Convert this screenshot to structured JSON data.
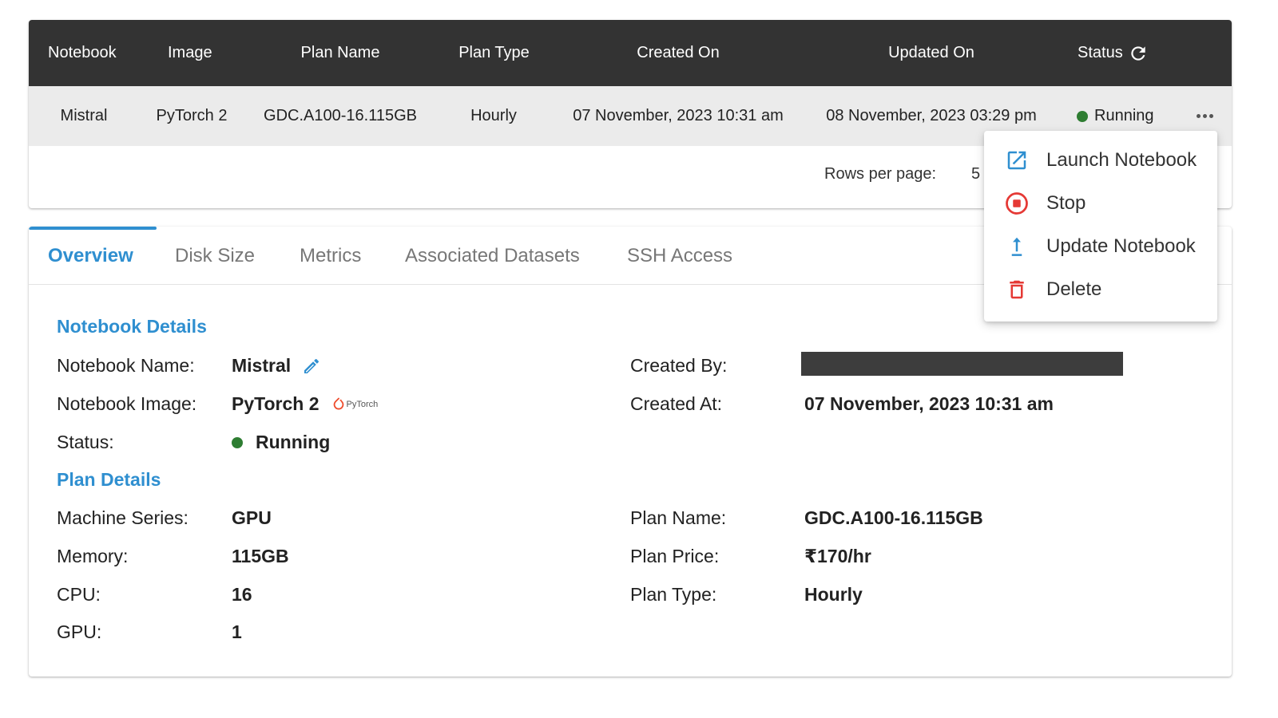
{
  "table": {
    "columns": [
      "Notebook",
      "Image",
      "Plan Name",
      "Plan Type",
      "Created On",
      "Updated On",
      "Status"
    ],
    "row": {
      "notebook": "Mistral",
      "image": "PyTorch 2",
      "plan_name": "GDC.A100-16.115GB",
      "plan_type": "Hourly",
      "created_on": "07 November, 2023 10:31 am",
      "updated_on": "08 November, 2023 03:29 pm",
      "status": "Running",
      "status_color": "#2e7d32"
    },
    "pagination": {
      "rows_per_page_label": "Rows per page:",
      "rows_per_page_value": "5"
    }
  },
  "menu": {
    "items": [
      {
        "label": "Launch Notebook",
        "icon": "launch-icon",
        "color": "#2f8fd0"
      },
      {
        "label": "Stop",
        "icon": "stop-icon",
        "color": "#e53935"
      },
      {
        "label": "Update Notebook",
        "icon": "upload-icon",
        "color": "#2f8fd0"
      },
      {
        "label": "Delete",
        "icon": "trash-icon",
        "color": "#e53935"
      }
    ]
  },
  "tabs": [
    "Overview",
    "Disk Size",
    "Metrics",
    "Associated Datasets",
    "SSH Access"
  ],
  "active_tab": "Overview",
  "accent_color": "#2f8fd0",
  "details": {
    "notebook_section_title": "Notebook Details",
    "notebook_name_label": "Notebook Name:",
    "notebook_name": "Mistral",
    "notebook_image_label": "Notebook Image:",
    "notebook_image": "PyTorch 2",
    "pytorch_logo_text": "PyTorch",
    "status_label": "Status:",
    "status": "Running",
    "created_by_label": "Created By:",
    "created_at_label": "Created At:",
    "created_at": "07 November, 2023 10:31 am",
    "plan_section_title": "Plan Details",
    "machine_series_label": "Machine Series:",
    "machine_series": "GPU",
    "memory_label": "Memory:",
    "memory": "115GB",
    "cpu_label": "CPU:",
    "cpu": "16",
    "gpu_label": "GPU:",
    "gpu": "1",
    "plan_name_label": "Plan Name:",
    "plan_name": "GDC.A100-16.115GB",
    "plan_price_label": "Plan Price:",
    "plan_price": "₹170/hr",
    "plan_type_label": "Plan Type:",
    "plan_type": "Hourly"
  }
}
